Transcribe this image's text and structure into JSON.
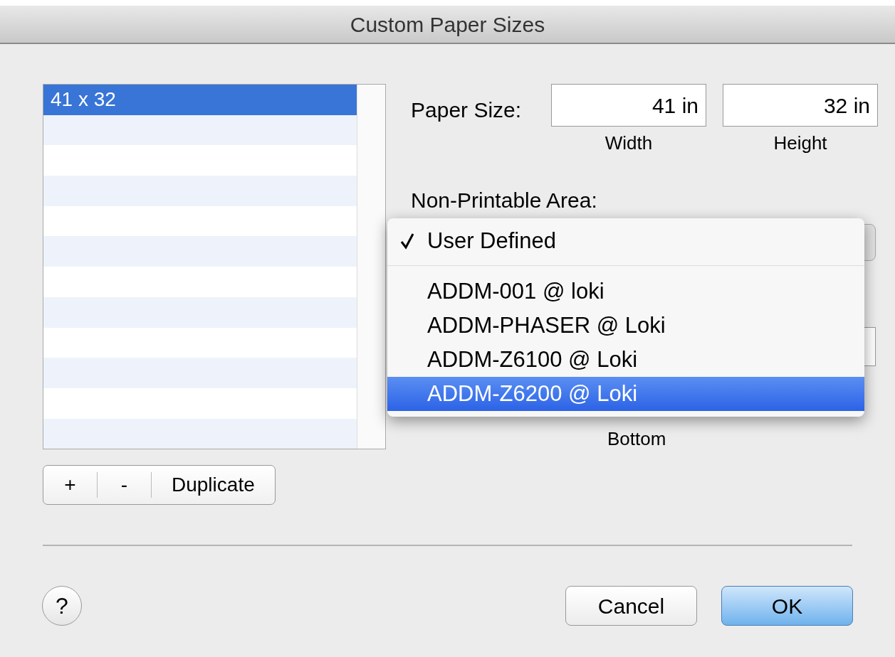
{
  "window": {
    "title": "Custom Paper Sizes"
  },
  "sizes_list": {
    "items": [
      {
        "label": "41 x 32",
        "selected": true
      }
    ]
  },
  "paper_size": {
    "label": "Paper Size:",
    "fields": [
      {
        "value": "41 in",
        "caption": "Width"
      },
      {
        "value": "32 in",
        "caption": "Height"
      }
    ]
  },
  "non_printable_area": {
    "label": "Non-Printable Area:",
    "menu": {
      "groups": [
        [
          {
            "label": "User Defined",
            "checked": true,
            "selected": false
          }
        ],
        [
          {
            "label": "ADDM-001 @ loki",
            "checked": false,
            "selected": false
          },
          {
            "label": "ADDM-PHASER @ Loki",
            "checked": false,
            "selected": false
          },
          {
            "label": "ADDM-Z6100 @ Loki",
            "checked": false,
            "selected": false
          },
          {
            "label": "ADDM-Z6200 @ Loki",
            "checked": false,
            "selected": true
          }
        ]
      ]
    },
    "bottom_caption": "Bottom"
  },
  "list_buttons": [
    "+",
    "-",
    "Duplicate"
  ],
  "footer": {
    "help": "?",
    "buttons": [
      {
        "label": "Cancel",
        "default": false
      },
      {
        "label": "OK",
        "default": true
      }
    ]
  }
}
